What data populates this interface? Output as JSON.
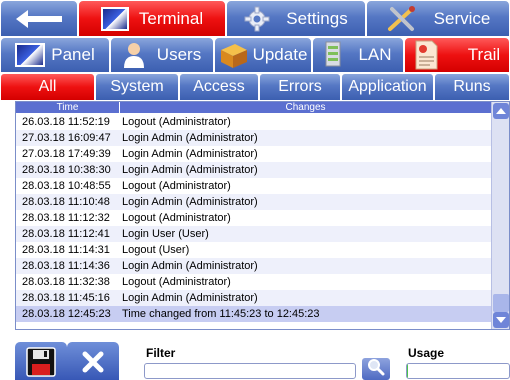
{
  "top_tabs": [
    {
      "id": "back",
      "label": "",
      "icon": "back-arrow-icon"
    },
    {
      "id": "terminal",
      "label": "Terminal",
      "icon": "monitor-icon",
      "active": true
    },
    {
      "id": "settings",
      "label": "Settings",
      "icon": "gear-icon"
    },
    {
      "id": "service",
      "label": "Service",
      "icon": "tools-icon"
    }
  ],
  "sub_tabs": [
    {
      "id": "panel",
      "label": "Panel",
      "icon": "monitor-icon"
    },
    {
      "id": "users",
      "label": "Users",
      "icon": "users-icon"
    },
    {
      "id": "update",
      "label": "Update",
      "icon": "software-box-icon"
    },
    {
      "id": "lan",
      "label": "LAN",
      "icon": "network-server-icon"
    },
    {
      "id": "trail",
      "label": "Trail",
      "icon": "audit-document-icon",
      "active": true
    }
  ],
  "category_tabs": [
    {
      "id": "all",
      "label": "All",
      "active": true
    },
    {
      "id": "system",
      "label": "System"
    },
    {
      "id": "access",
      "label": "Access"
    },
    {
      "id": "errors",
      "label": "Errors"
    },
    {
      "id": "application",
      "label": "Application"
    },
    {
      "id": "runs",
      "label": "Runs"
    }
  ],
  "list": {
    "columns": {
      "time": "Time",
      "changes": "Changes"
    },
    "rows": [
      {
        "time": "26.03.18 11:52:19",
        "changes": "Logout (Administrator)"
      },
      {
        "time": "27.03.18 16:09:47",
        "changes": "Login Admin (Administrator)"
      },
      {
        "time": "27.03.18 17:49:39",
        "changes": "Login Admin (Administrator)"
      },
      {
        "time": "28.03.18 10:38:30",
        "changes": "Login Admin (Administrator)"
      },
      {
        "time": "28.03.18 10:48:55",
        "changes": "Logout (Administrator)"
      },
      {
        "time": "28.03.18 11:10:48",
        "changes": "Login Admin (Administrator)"
      },
      {
        "time": "28.03.18 11:12:32",
        "changes": "Logout (Administrator)"
      },
      {
        "time": "28.03.18 11:12:41",
        "changes": "Login User (User)"
      },
      {
        "time": "28.03.18 11:14:31",
        "changes": "Logout (User)"
      },
      {
        "time": "28.03.18 11:14:36",
        "changes": "Login Admin (Administrator)"
      },
      {
        "time": "28.03.18 11:32:38",
        "changes": "Logout (Administrator)"
      },
      {
        "time": "28.03.18 11:45:16",
        "changes": "Login Admin (Administrator)"
      },
      {
        "time": "28.03.18 12:45:23",
        "changes": "Time changed from 11:45:23 to 12:45:23",
        "selected": true
      }
    ]
  },
  "bottom": {
    "filter_label": "Filter",
    "filter_value": "",
    "usage_label": "Usage",
    "usage_fraction": 0.01
  },
  "colors": {
    "tab_blue": "#4a6bbf",
    "tab_active_red": "#e80c0c",
    "header_blue": "#5b6fd0",
    "usage_green": "#4cc24c"
  }
}
